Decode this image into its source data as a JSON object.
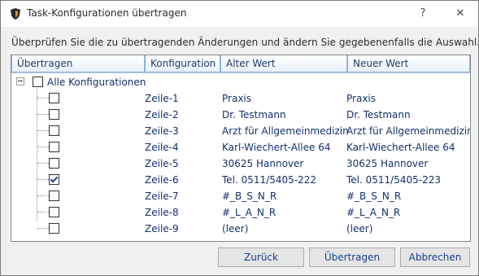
{
  "window": {
    "title": "Task-Konfigurationen übertragen",
    "help_glyph": "?",
    "close_glyph": "✕",
    "icon": "shield-app-icon"
  },
  "instruction": "Überprüfen Sie die zu übertragenden Änderungen und ändern Sie gegebenenfalls die Auswahl.",
  "table": {
    "headers": [
      "Übertragen",
      "Konfiguration",
      "Alter Wert",
      "Neuer Wert"
    ],
    "root": {
      "label": "Alle Konfigurationen",
      "checked": false,
      "expanded": true
    },
    "rows": [
      {
        "config": "Zeile-1",
        "old": "Praxis",
        "new": "Praxis",
        "checked": false
      },
      {
        "config": "Zeile-2",
        "old": "Dr. Testmann",
        "new": "Dr. Testmann",
        "checked": false
      },
      {
        "config": "Zeile-3",
        "old": "Arzt für Allgemeinmedizin",
        "new": "Arzt für Allgemeinmedizin",
        "checked": false
      },
      {
        "config": "Zeile-4",
        "old": "Karl-Wiechert-Allee 64",
        "new": "Karl-Wiechert-Allee 64",
        "checked": false
      },
      {
        "config": "Zeile-5",
        "old": "30625 Hannover",
        "new": "30625 Hannover",
        "checked": false
      },
      {
        "config": "Zeile-6",
        "old": "Tel. 0511/5405-222",
        "new": "Tel. 0511/5405-223",
        "checked": true
      },
      {
        "config": "Zeile-7",
        "old": "#_B_S_N_R",
        "new": "#_B_S_N_R",
        "checked": false
      },
      {
        "config": "Zeile-8",
        "old": "#_L_A_N_R",
        "new": "#_L_A_N_R",
        "checked": false
      },
      {
        "config": "Zeile-9",
        "old": "(leer)",
        "new": "(leer)",
        "checked": false
      }
    ]
  },
  "buttons": {
    "back": "Zurück",
    "transfer": "Übertragen",
    "cancel": "Abbrechen"
  }
}
